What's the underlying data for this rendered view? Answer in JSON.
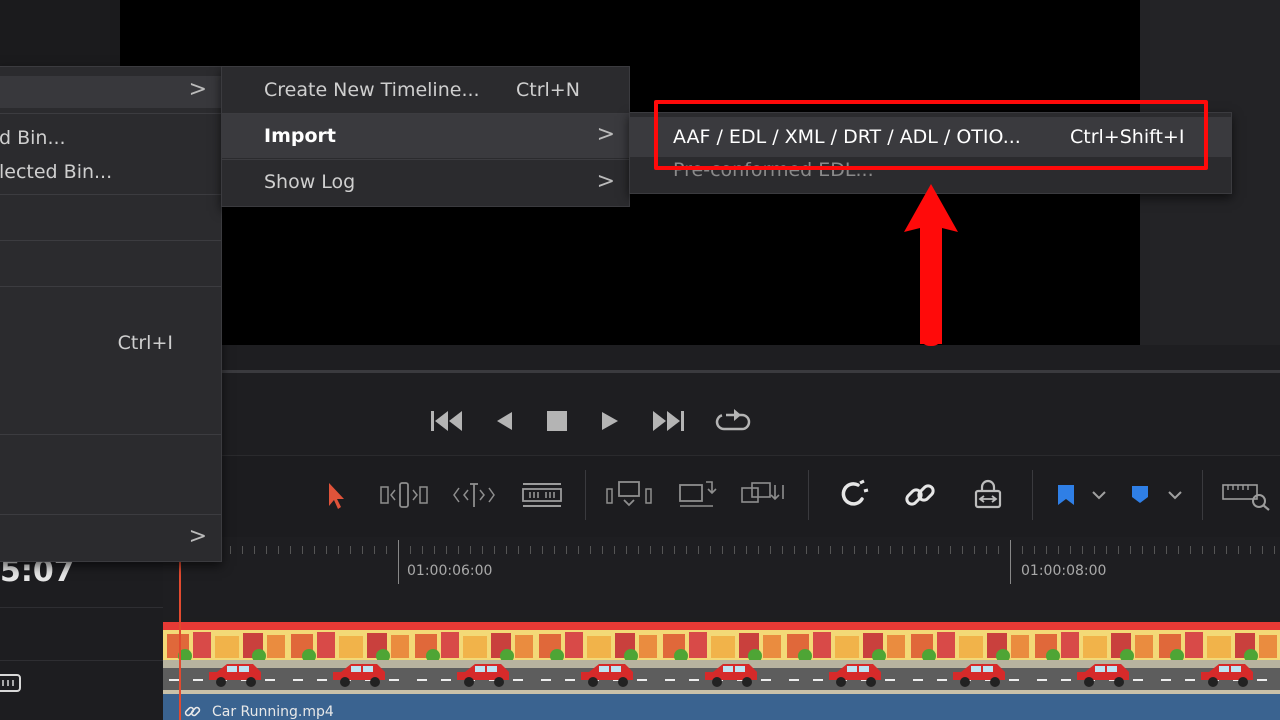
{
  "file_menu": {
    "items": [
      {
        "label": "",
        "has_submenu": true
      },
      {
        "label": "d Bin..."
      },
      {
        "label": "lected Bin..."
      },
      {
        "label": ""
      },
      {
        "label": ""
      },
      {
        "label": "",
        "shortcut": "Ctrl+I"
      },
      {
        "label": ""
      },
      {
        "label": "",
        "has_submenu": true
      }
    ]
  },
  "timelines_submenu": {
    "items": [
      {
        "label": "Create New Timeline...",
        "shortcut": "Ctrl+N"
      },
      {
        "label": "Import",
        "has_submenu": true,
        "highlighted": true
      },
      {
        "label": "Show Log",
        "has_submenu": true
      }
    ]
  },
  "import_submenu": {
    "items": [
      {
        "label": "AAF / EDL / XML / DRT / ADL / OTIO...",
        "shortcut": "Ctrl+Shift+I",
        "highlighted": true
      },
      {
        "label": "Pre-conformed EDL..."
      }
    ]
  },
  "transport": {
    "icons": [
      "jump-to-start-icon",
      "play-reverse-icon",
      "stop-icon",
      "play-icon",
      "jump-to-end-icon",
      "loop-icon"
    ]
  },
  "toolbar": {
    "icons": [
      "selection-mode-icon",
      "trim-edit-icon",
      "dynamic-trim-icon",
      "blade-edit-icon",
      "insert-clip-icon",
      "overwrite-clip-icon",
      "replace-clip-icon",
      "snapping-icon",
      "linked-selection-icon",
      "position-lock-icon",
      "flag-icon",
      "marker-icon",
      "zoom-icon"
    ]
  },
  "timeline": {
    "timecode": "5:07",
    "ruler_labels": [
      "01:00:06:00",
      "01:00:08:00"
    ],
    "clip_name": "Car Running.mp4"
  },
  "colors": {
    "annotation": "#ff0a0a",
    "playhead": "#e24a2f",
    "clip_bar": "#3a6390",
    "selection_tool": "#e0533a",
    "flag": "#2f7fe6"
  }
}
